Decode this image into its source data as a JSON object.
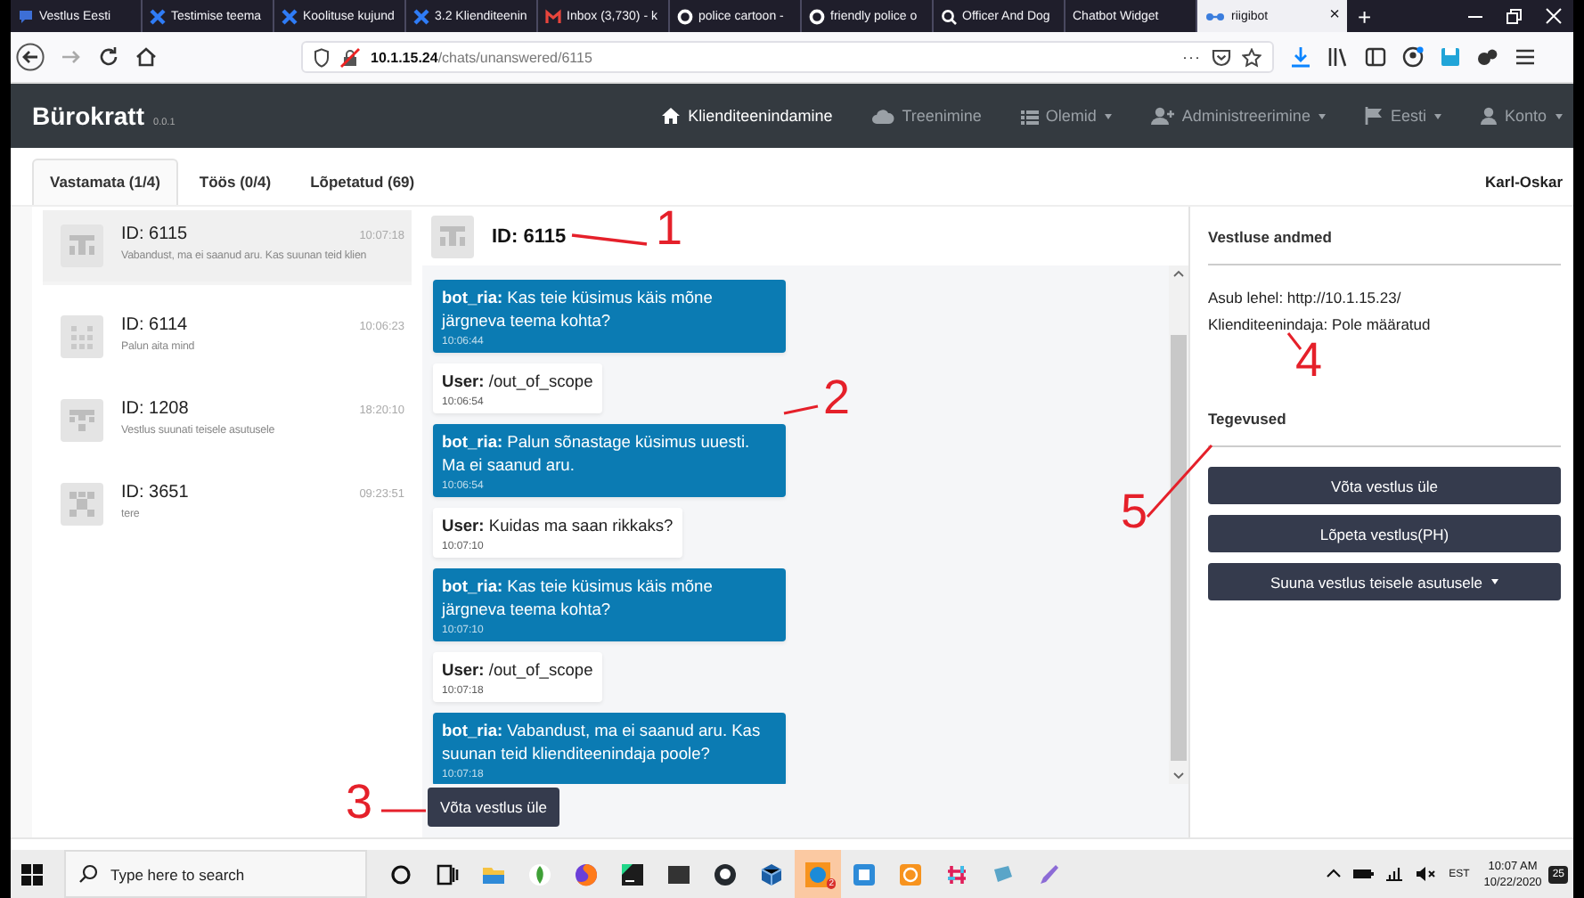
{
  "browser": {
    "tabs": [
      {
        "label": "Vestlus Eesti",
        "selected": false
      },
      {
        "label": "Testimise teema",
        "selected": false
      },
      {
        "label": "Koolituse kujund",
        "selected": false
      },
      {
        "label": "3.2 Klienditeenin",
        "selected": false
      },
      {
        "label": "Inbox (3,730) - k",
        "selected": false
      },
      {
        "label": "police cartoon -",
        "selected": false
      },
      {
        "label": "friendly police o",
        "selected": false
      },
      {
        "label": "Officer And Dog",
        "selected": false
      },
      {
        "label": "Chatbot Widget",
        "selected": false
      },
      {
        "label": "riigibot",
        "selected": true
      }
    ],
    "close_tab": "×",
    "new_tab": "+",
    "url": "**10.1.15.24**/chats/unanswered/6115",
    "page_actions": "···"
  },
  "app": {
    "brand": "Bürokratt",
    "version": "0.0.1",
    "nav": [
      {
        "label": "Klienditeenindamine",
        "active": true,
        "dropdown": false
      },
      {
        "label": "Treenimine",
        "active": false,
        "dropdown": false
      },
      {
        "label": "Olemid",
        "active": false,
        "dropdown": true
      },
      {
        "label": "Administreerimine",
        "active": false,
        "dropdown": true
      },
      {
        "label": "Eesti",
        "active": false,
        "dropdown": true
      },
      {
        "label": "Konto",
        "active": false,
        "dropdown": true
      }
    ]
  },
  "tabs": [
    {
      "label": "Vastamata (1/4)",
      "selected": true
    },
    {
      "label": "Töös (0/4)",
      "selected": false
    },
    {
      "label": "Lõpetatud (69)",
      "selected": false
    }
  ],
  "user_name": "Karl-Oskar",
  "chats": [
    {
      "id": "ID: 6115",
      "time": "10:07:18",
      "preview": "Vabandust, ma ei saanud aru. Kas suunan teid klien",
      "selected": true
    },
    {
      "id": "ID: 6114",
      "time": "10:06:23",
      "preview": "Palun aita mind",
      "selected": false
    },
    {
      "id": "ID: 1208",
      "time": "18:20:10",
      "preview": "Vestlus suunati teisele asutusele",
      "selected": false
    },
    {
      "id": "ID: 3651",
      "time": "09:23:51",
      "preview": "tere",
      "selected": false
    }
  ],
  "conversation": {
    "title": "ID: 6115",
    "messages": [
      {
        "kind": "bot",
        "sender": "bot_ria:",
        "text": "Kas teie küsimus käis mõne järgneva teema kohta?",
        "time": "10:06:44"
      },
      {
        "kind": "user",
        "sender": "User:",
        "text": "/out_of_scope",
        "time": "10:06:54"
      },
      {
        "kind": "bot",
        "sender": "bot_ria:",
        "text": "Palun sõnastage küsimus uuesti. Ma ei saanud aru.",
        "time": "10:06:54"
      },
      {
        "kind": "user",
        "sender": "User:",
        "text": "Kuidas ma saan rikkaks?",
        "time": "10:07:10"
      },
      {
        "kind": "bot",
        "sender": "bot_ria:",
        "text": "Kas teie küsimus käis mõne järgneva teema kohta?",
        "time": "10:07:10"
      },
      {
        "kind": "user",
        "sender": "User:",
        "text": "/out_of_scope",
        "time": "10:07:18"
      },
      {
        "kind": "bot",
        "sender": "bot_ria:",
        "text": "Vabandust, ma ei saanud aru. Kas suunan teid klienditeenindaja poole?",
        "time": "10:07:18"
      }
    ],
    "takeover_button": "Võta vestlus üle"
  },
  "details": {
    "title": "Vestluse andmed",
    "lines": [
      "Asub lehel: http://10.1.15.23/",
      "Klienditeenindaja: Pole määratud"
    ],
    "actions_title": "Tegevused",
    "actions": [
      {
        "label": "Võta vestlus üle",
        "dropdown": false
      },
      {
        "label": "Lõpeta vestlus(PH)",
        "dropdown": false
      },
      {
        "label": "Suuna vestlus teisele asutusele",
        "dropdown": true
      }
    ]
  },
  "annotations": [
    "1",
    "2",
    "3",
    "4",
    "5"
  ],
  "taskbar": {
    "search_placeholder": "Type here to search",
    "badge": "2",
    "tray_label": "EST",
    "time": "10:07 AM",
    "date": "10/22/2020",
    "notifications": "25"
  }
}
